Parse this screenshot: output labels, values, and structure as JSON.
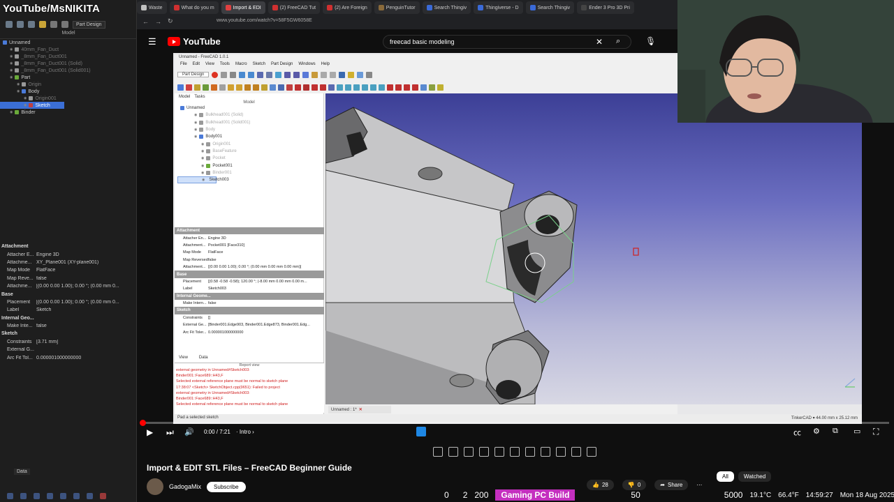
{
  "channel_watermark": "YouTube/MsNIKITA",
  "browser": {
    "tabs": [
      {
        "label": "Waste",
        "active": false
      },
      {
        "label": "What do you m",
        "active": false
      },
      {
        "label": "Import & EDI",
        "active": true
      },
      {
        "label": "(2) FreeCAD Tut",
        "active": false
      },
      {
        "label": "(2) Are Foreign",
        "active": false
      },
      {
        "label": "PenguinTutor",
        "active": false
      },
      {
        "label": "Search Thingiv",
        "active": false
      },
      {
        "label": "Thingiverse - D",
        "active": false
      },
      {
        "label": "Search Thingiv",
        "active": false
      },
      {
        "label": "Ender 3 Pro 3D Pri",
        "active": false
      }
    ],
    "url": "www.youtube.com/watch?v=58F5GW6058E"
  },
  "outer_freecad": {
    "workbench": "Part Design",
    "model_header": "Model",
    "tree": [
      {
        "label": "Unnamed",
        "indent": 0,
        "state": "normal"
      },
      {
        "label": "40mm_Fan_Duct",
        "indent": 1,
        "state": "dim"
      },
      {
        "label": "_8mm_Fan_Duct001",
        "indent": 1,
        "state": "dim"
      },
      {
        "label": "_8mm_Fan_Duct001 (Solid)",
        "indent": 1,
        "state": "dim"
      },
      {
        "label": "_8mm_Fan_Duct001 (Solid001)",
        "indent": 1,
        "state": "dim"
      },
      {
        "label": "Part",
        "indent": 1,
        "state": "normal"
      },
      {
        "label": "Origin",
        "indent": 2,
        "state": "dim"
      },
      {
        "label": "Body",
        "indent": 2,
        "state": "normal"
      },
      {
        "label": "Origin001",
        "indent": 3,
        "state": "dim"
      },
      {
        "label": "Sketch",
        "indent": 3,
        "state": "selected"
      },
      {
        "label": "Binder",
        "indent": 1,
        "state": "normal"
      }
    ],
    "properties": [
      {
        "group": "Attachment"
      },
      {
        "k": "Attacher E...",
        "v": "Engine 3D"
      },
      {
        "k": "Attachme...",
        "v": "XY_Plane001 (XY-plane001)"
      },
      {
        "k": "Map Mode",
        "v": "FlatFace"
      },
      {
        "k": "Map Reve...",
        "v": "false"
      },
      {
        "k": "Attachme...",
        "v": "[(0.00 0.00 1.00); 0.00 °; (0.00 mm 0..."
      },
      {
        "group": "Base"
      },
      {
        "k": "Placement",
        "v": "[(0.00 0.00 1.00); 0.00 °; (0.00 mm 0..."
      },
      {
        "k": "Label",
        "v": "Sketch"
      },
      {
        "group": "Internal Geo..."
      },
      {
        "k": "Make Inte...",
        "v": "false"
      },
      {
        "group": "Sketch"
      },
      {
        "k": "Constraints",
        "v": "[3.71 mm]"
      },
      {
        "k": "External G...",
        "v": ""
      },
      {
        "k": "Arc Fit Tol...",
        "v": "0.000001000000000"
      }
    ],
    "data_tab": "Data"
  },
  "youtube": {
    "brand": "YouTube",
    "search_query": "freecad basic modeling",
    "video_title": "Import & EDIT STL Files – FreeCAD Beginner Guide",
    "channel_name": "GadogaMix",
    "subscribe_label": "Subscribe",
    "like_count": "28",
    "dislike_count": "0",
    "share_label": "Share",
    "chips": [
      {
        "label": "All",
        "active": true
      },
      {
        "label": "Watched",
        "active": false
      }
    ],
    "time_display": "0:00 / 7:21",
    "chapter": "Intro",
    "progress": 0.0
  },
  "inner_freecad": {
    "title": "Unnamed - FreeCAD 1.0.1",
    "menu": [
      "File",
      "Edit",
      "View",
      "Tools",
      "Macro",
      "Sketch",
      "Part Design",
      "Windows",
      "Help"
    ],
    "workbench": "Part Design",
    "combo_tabs": [
      "Model",
      "Tasks"
    ],
    "model_header": "Model",
    "tree": [
      {
        "label": "Unnamed",
        "indent": 0,
        "state": "normal"
      },
      {
        "label": "Bulkhead001 (Solid)",
        "indent": 2,
        "state": "dim"
      },
      {
        "label": "Bulkhead001 (Solid001)",
        "indent": 2,
        "state": "dim"
      },
      {
        "label": "Body",
        "indent": 2,
        "state": "dim"
      },
      {
        "label": "Body001",
        "indent": 2,
        "state": "normal"
      },
      {
        "label": "Origin001",
        "indent": 3,
        "state": "dim"
      },
      {
        "label": "BaseFeature",
        "indent": 3,
        "state": "dim"
      },
      {
        "label": "Pocket",
        "indent": 3,
        "state": "dim"
      },
      {
        "label": "Pocket001",
        "indent": 3,
        "state": "normal"
      },
      {
        "label": "Binder001",
        "indent": 3,
        "state": "dim"
      },
      {
        "label": "Sketch003",
        "indent": 3,
        "state": "selected"
      }
    ],
    "properties": [
      {
        "group": "Attachment"
      },
      {
        "k": "Attacher En...",
        "v": "Engine 3D"
      },
      {
        "k": "Attachment...",
        "v": "Pocket001 [Face310]"
      },
      {
        "k": "Map Mode",
        "v": "FlatFace"
      },
      {
        "k": "Map Reversed",
        "v": "false"
      },
      {
        "k": "Attachment...",
        "v": "[(0.00 0.00 1.00); 0.00 °; (0.00 mm 0.00 mm 0.00 mm)]"
      },
      {
        "group": "Base"
      },
      {
        "k": "Placement",
        "v": "[(0.58 -0.58 -0.58); 120.00 °; (-8.00 mm 0.00 mm 0.00 m..."
      },
      {
        "k": "Label",
        "v": "Sketch003"
      },
      {
        "group": "Internal Geome..."
      },
      {
        "k": "Make Intern...",
        "v": "false"
      },
      {
        "group": "Sketch"
      },
      {
        "k": "Constraints",
        "v": "[]"
      },
      {
        "k": "External Ge...",
        "v": "[Binder001.Edge903, Binder001.Edge873, Binder001.Edg..."
      },
      {
        "k": "Arc Fit Toler...",
        "v": "0.000001000000000"
      }
    ],
    "view_tab": "View",
    "data_tab": "Data",
    "report_title": "Report view",
    "report_lines": [
      "external geometry in Unnamed#Sketch003:",
      "Binder001::Face689::H43,F",
      "Selected external reference plane must be normal to sketch plane",
      "17:38:07  <Sketch> SketchObject.cpp(9651): Failed to project",
      "external geometry in Unnamed#Sketch003:",
      "Binder001::Face689::H43,F",
      "Selected external reference plane must be normal to sketch plane"
    ],
    "doc_tab": "Unnamed : 1*",
    "status_left": "Pad a selected sketch",
    "status_right": "TinkerCAD  ▾   44.00 mm x 25.12 mm"
  },
  "stream_overlay": {
    "v1": "0",
    "v2": "2",
    "v3": "200",
    "build_label": "Gaming PC Build",
    "v4": "50",
    "v5": "5000",
    "temp": "19.1°C",
    "temp_f": "66.4°F",
    "clock": "14:59:27",
    "date": "Mon 18 Aug 2025"
  },
  "colors": {
    "yt_red": "#ff0000",
    "build_bg": "#c42fbf",
    "selection_blue": "#3b6fd6",
    "viewport_top": "#3c3f96"
  }
}
